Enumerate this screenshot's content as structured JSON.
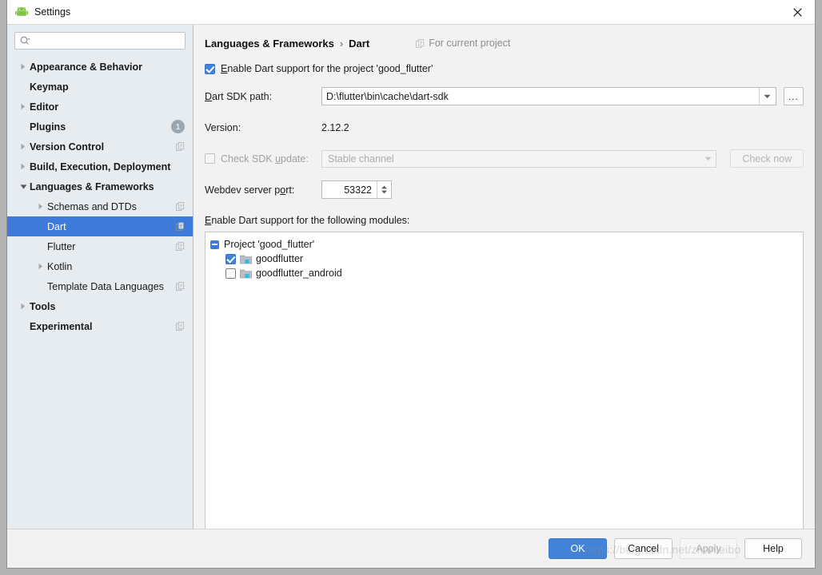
{
  "window": {
    "title": "Settings",
    "app_icon": "android-icon",
    "close_icon": "close-icon"
  },
  "sidebar": {
    "search": {
      "placeholder": "",
      "value": "",
      "icon": "search-icon"
    },
    "items": [
      {
        "label": "Appearance & Behavior",
        "arrow": "collapsed",
        "bold": true,
        "badge": null,
        "copy": false,
        "indent": 0,
        "selected": false
      },
      {
        "label": "Keymap",
        "arrow": "none",
        "bold": true,
        "badge": null,
        "copy": false,
        "indent": 0,
        "selected": false
      },
      {
        "label": "Editor",
        "arrow": "collapsed",
        "bold": true,
        "badge": null,
        "copy": false,
        "indent": 0,
        "selected": false
      },
      {
        "label": "Plugins",
        "arrow": "none",
        "bold": true,
        "badge": "1",
        "copy": false,
        "indent": 0,
        "selected": false
      },
      {
        "label": "Version Control",
        "arrow": "collapsed",
        "bold": true,
        "badge": null,
        "copy": true,
        "indent": 0,
        "selected": false
      },
      {
        "label": "Build, Execution, Deployment",
        "arrow": "collapsed",
        "bold": true,
        "badge": null,
        "copy": false,
        "indent": 0,
        "selected": false
      },
      {
        "label": "Languages & Frameworks",
        "arrow": "expanded",
        "bold": true,
        "badge": null,
        "copy": false,
        "indent": 0,
        "selected": false
      },
      {
        "label": "Schemas and DTDs",
        "arrow": "collapsed",
        "bold": false,
        "badge": null,
        "copy": true,
        "indent": 1,
        "selected": false
      },
      {
        "label": "Dart",
        "arrow": "none",
        "bold": false,
        "badge": null,
        "copy": true,
        "indent": 1,
        "selected": true
      },
      {
        "label": "Flutter",
        "arrow": "none",
        "bold": false,
        "badge": null,
        "copy": true,
        "indent": 1,
        "selected": false
      },
      {
        "label": "Kotlin",
        "arrow": "collapsed",
        "bold": false,
        "badge": null,
        "copy": false,
        "indent": 1,
        "selected": false
      },
      {
        "label": "Template Data Languages",
        "arrow": "none",
        "bold": false,
        "badge": null,
        "copy": true,
        "indent": 1,
        "selected": false
      },
      {
        "label": "Tools",
        "arrow": "collapsed",
        "bold": true,
        "badge": null,
        "copy": false,
        "indent": 0,
        "selected": false
      },
      {
        "label": "Experimental",
        "arrow": "none",
        "bold": true,
        "badge": null,
        "copy": true,
        "indent": 0,
        "selected": false
      }
    ]
  },
  "content": {
    "breadcrumb": {
      "parent": "Languages & Frameworks",
      "separator": "›",
      "current": "Dart"
    },
    "for_current_project": "For current project",
    "enable_support": {
      "label": "Enable Dart support for the project 'good_flutter'",
      "checked": true
    },
    "sdk_path": {
      "label": "Dart SDK path:",
      "value": "D:\\flutter\\bin\\cache\\dart-sdk",
      "browse_label": "..."
    },
    "version": {
      "label": "Version:",
      "value": "2.12.2"
    },
    "check_update": {
      "label": "Check SDK update:",
      "checked": false,
      "channel": "Stable channel",
      "button_label": "Check now",
      "disabled": true
    },
    "webdev": {
      "label": "Webdev server port:",
      "value": "53322"
    },
    "modules": {
      "label": "Enable Dart support for the following modules:",
      "root": "Project 'good_flutter'",
      "items": [
        {
          "name": "goodflutter",
          "checked": true
        },
        {
          "name": "goodflutter_android",
          "checked": false
        }
      ]
    }
  },
  "footer": {
    "ok": "OK",
    "cancel": "Cancel",
    "apply": "Apply",
    "help": "Help",
    "watermark": "https://blog.csdn.net/zhanleibo"
  },
  "colors": {
    "accent": "#3d7ad9",
    "sidebar_bg": "#e7ecf0",
    "content_bg": "#f2f2f2"
  }
}
